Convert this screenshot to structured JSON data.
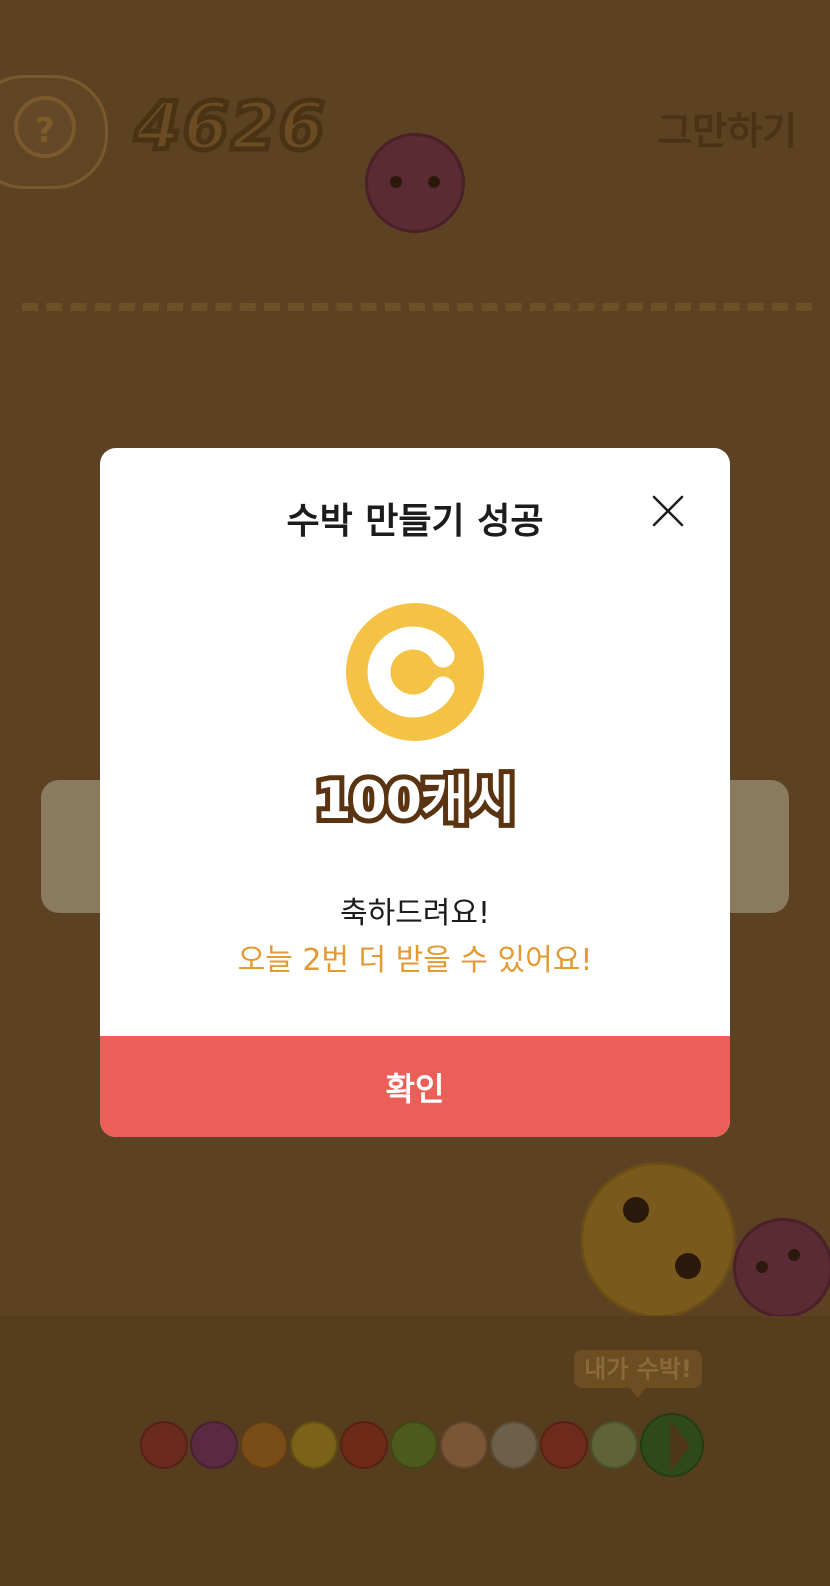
{
  "colors": {
    "dim_background": "#5c4222",
    "modal_background": "#ffffff",
    "coin": "#f4c244",
    "confirm_button": "#ec5f58",
    "highlight_text": "#e39a32"
  },
  "game": {
    "help_label": "?",
    "score": "4626",
    "quit_label": "그만하기",
    "watermelon_tooltip": "내가 수박!"
  },
  "modal": {
    "title": "수박 만들기 성공",
    "close_icon": "close-x-icon",
    "coin_icon": "cash-coin-icon",
    "coin_letter": "C",
    "reward": "100캐시",
    "congrats": "축하드려요!",
    "remaining": "오늘 2번 더 받을 수 있어요!",
    "confirm_label": "확인"
  }
}
